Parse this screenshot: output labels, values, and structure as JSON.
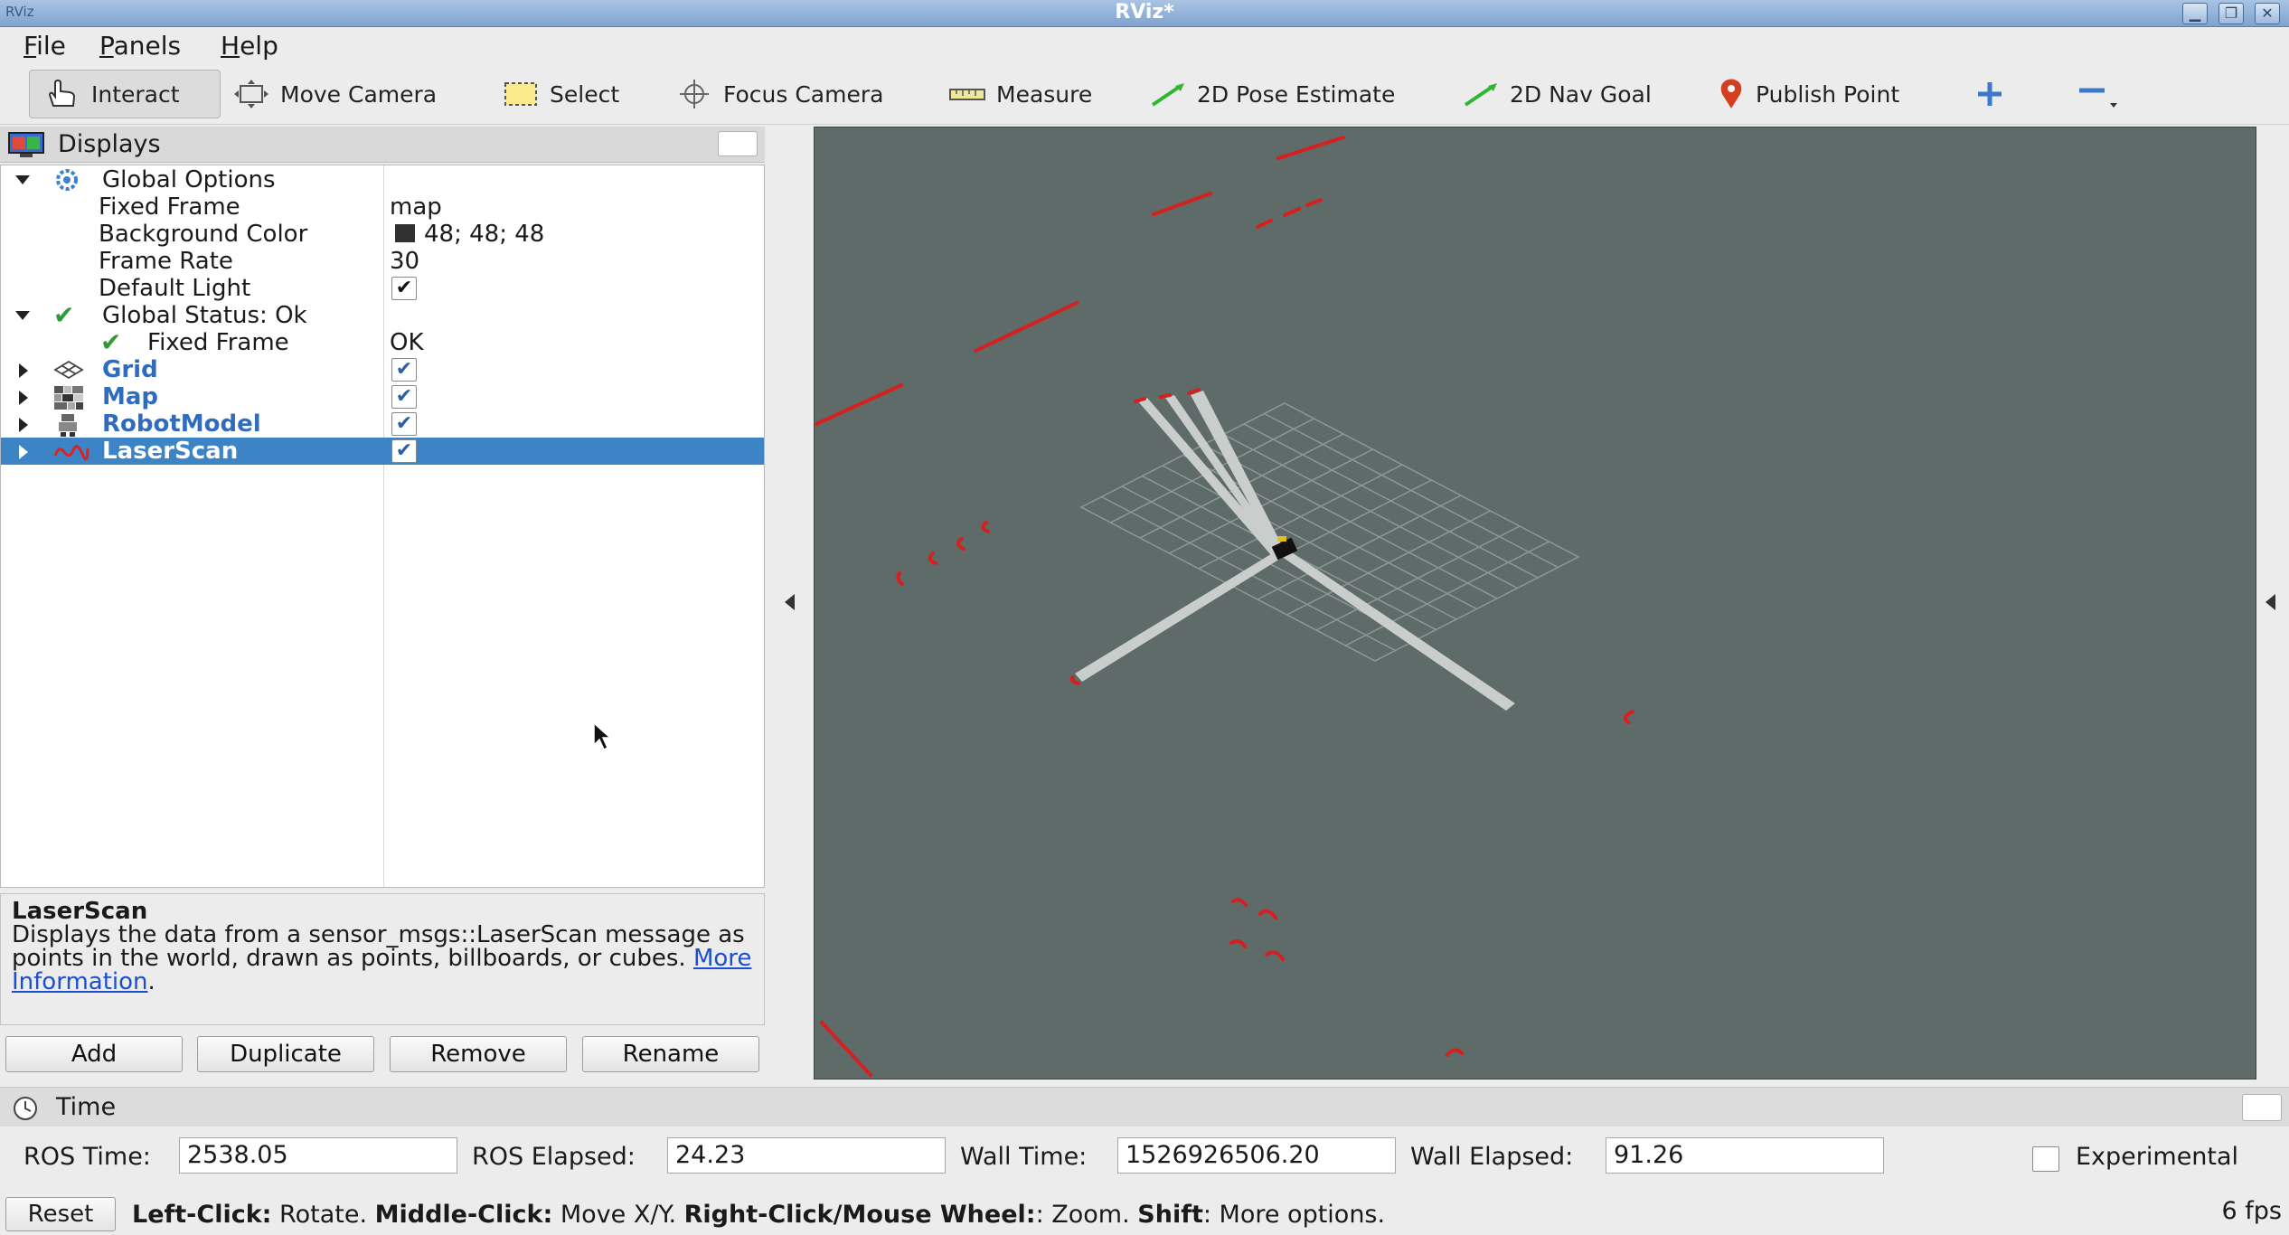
{
  "window": {
    "title": "RViz*",
    "app_icon_label": "RViz"
  },
  "menu": [
    {
      "label": "File",
      "mnemonic": "F",
      "rest": "ile"
    },
    {
      "label": "Panels",
      "mnemonic": "P",
      "rest": "anels"
    },
    {
      "label": "Help",
      "mnemonic": "H",
      "rest": "elp"
    }
  ],
  "toolbar": {
    "interact": "Interact",
    "move_camera": "Move Camera",
    "select": "Select",
    "focus_camera": "Focus Camera",
    "measure": "Measure",
    "pose_estimate": "2D Pose Estimate",
    "nav_goal": "2D Nav Goal",
    "publish_point": "Publish Point",
    "icons": [
      "hand-icon",
      "move-camera-icon",
      "select-icon",
      "focus-camera-icon",
      "ruler-icon",
      "green-arrow-icon",
      "green-arrow-icon",
      "map-pin-icon",
      "plus-icon",
      "minus-icon"
    ],
    "accent_colors": {
      "pose": "#2fb82f",
      "pin": "#d4401f",
      "plus_minus": "#3b78c9"
    }
  },
  "displays": {
    "title": "Displays",
    "global_options": {
      "label": "Global Options",
      "fixed_frame": {
        "label": "Fixed Frame",
        "value": "map"
      },
      "background_color": {
        "label": "Background Color",
        "value": "48; 48; 48",
        "swatch": "#303030"
      },
      "frame_rate": {
        "label": "Frame Rate",
        "value": "30"
      },
      "default_light": {
        "label": "Default Light",
        "checked": true
      }
    },
    "global_status": {
      "label": "Global Status: Ok",
      "fixed_frame": {
        "label": "Fixed Frame",
        "value": "OK"
      }
    },
    "items": [
      {
        "label": "Grid",
        "checked": true,
        "icon": "grid-icon"
      },
      {
        "label": "Map",
        "checked": true,
        "icon": "map-icon"
      },
      {
        "label": "RobotModel",
        "checked": true,
        "icon": "robot-icon"
      },
      {
        "label": "LaserScan",
        "checked": true,
        "icon": "laserscan-icon",
        "selected": true
      }
    ],
    "selection_color": "#3d84c6"
  },
  "description": {
    "title": "LaserScan",
    "text": "Displays the data from a sensor_msgs::LaserScan message as points in the world, drawn as points, billboards, or cubes.",
    "link": "More Information",
    "period": "."
  },
  "buttons": {
    "add": "Add",
    "duplicate": "Duplicate",
    "remove": "Remove",
    "rename": "Rename"
  },
  "viewport": {
    "background": "#5e6b69",
    "scan_color": "#d61f1f"
  },
  "time": {
    "title": "Time",
    "ros_time_label": "ROS Time:",
    "ros_time": "2538.05",
    "ros_elapsed_label": "ROS Elapsed:",
    "ros_elapsed": "24.23",
    "wall_time_label": "Wall Time:",
    "wall_time": "1526926506.20",
    "wall_elapsed_label": "Wall Elapsed:",
    "wall_elapsed": "91.26",
    "experimental_label": "Experimental"
  },
  "status": {
    "reset": "Reset",
    "hint_parts": [
      {
        "b": "Left-Click:",
        "t": " Rotate. "
      },
      {
        "b": "Middle-Click:",
        "t": " Move X/Y. "
      },
      {
        "b": "Right-Click/Mouse Wheel:",
        "t": ": Zoom. "
      },
      {
        "b": "Shift",
        "t": ": More options."
      }
    ],
    "fps": "6 fps"
  }
}
